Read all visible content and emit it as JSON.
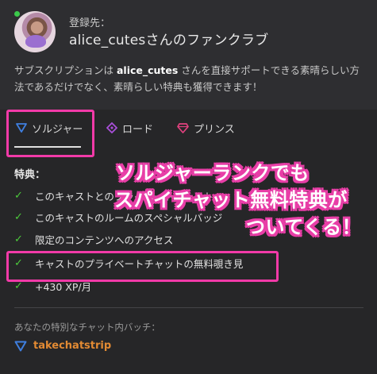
{
  "header": {
    "registered_label": "登録先：",
    "club_name": "alice_cutesさんのファンクラブ",
    "description_prefix": "サブスクリプションは ",
    "description_user": "alice_cutes",
    "description_suffix": " さんを直接サポートできる素晴らしい方法であるだけでなく、素晴らしい特典も獲得できます！"
  },
  "tabs": [
    {
      "label": "ソルジャー",
      "icon": "blue-triangle-icon",
      "color": "#3f7fe0",
      "active": true
    },
    {
      "label": "ロード",
      "icon": "purple-diamond-icon",
      "color": "#a94fd9",
      "active": false
    },
    {
      "label": "プリンス",
      "icon": "pink-gem-icon",
      "color": "#e2417f",
      "active": false
    }
  ],
  "perks": {
    "title": "特典：",
    "items": [
      "このキャストとのプライベートチャット",
      "このキャストのルームのスペシャルバッジ",
      "限定のコンテンツへのアクセス",
      "キャストのプライベートチャットの無料覗き見",
      "+430 XP/月"
    ]
  },
  "badge": {
    "label": "あなたの特別なチャット内バッチ：",
    "name": "takechatstrip",
    "icon": "blue-triangle-icon"
  },
  "overlay": {
    "line1": "ソルジャーランクでも",
    "line2": "スパイチャット無料特典が",
    "line3": "ついてくる！"
  },
  "colors": {
    "accent_pink": "#f23aa8",
    "check_green": "#4ccb3b",
    "badge_orange": "#e28a33"
  }
}
